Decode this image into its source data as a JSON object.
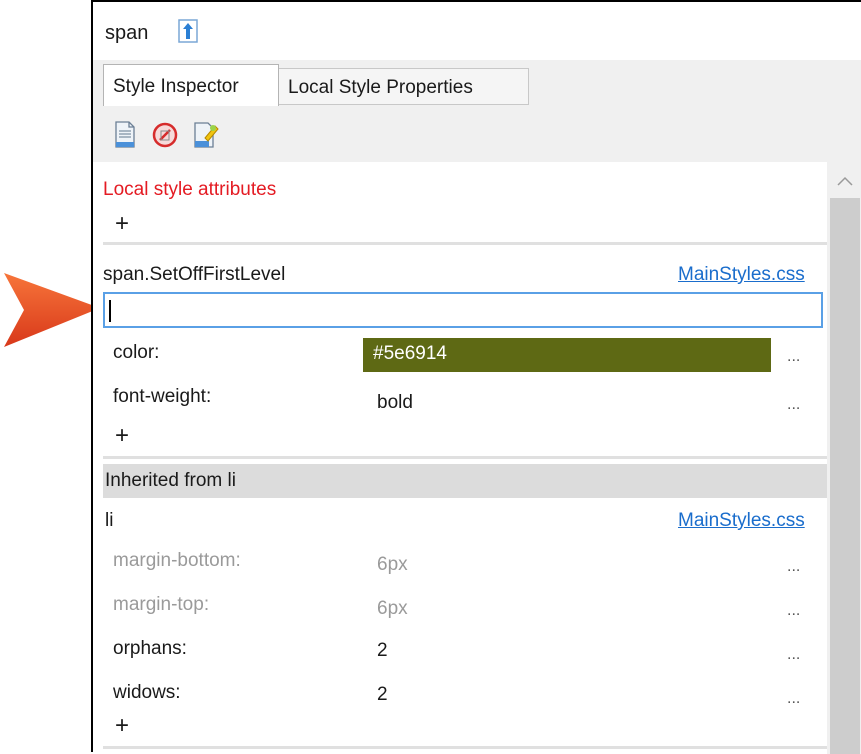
{
  "window": {
    "title": "span"
  },
  "tabs": [
    {
      "label": "Style Inspector",
      "active": true
    },
    {
      "label": "Local Style Properties",
      "active": false
    }
  ],
  "toolbar": {
    "icons": [
      "new-style-icon",
      "remove-style-icon",
      "edit-style-icon"
    ]
  },
  "local": {
    "heading": "Local style attributes",
    "add": "+"
  },
  "rule1": {
    "selector": "span.SetOffFirstLevel",
    "source": "MainStyles.css",
    "new_property_value": "",
    "add": "+",
    "properties": [
      {
        "name": "color:",
        "value": "#5e6914",
        "swatch": "#5e6914",
        "more": "..."
      },
      {
        "name": "font-weight:",
        "value": "bold",
        "more": "..."
      }
    ]
  },
  "inherited": {
    "heading": "Inherited from li",
    "selector": "li",
    "source": "MainStyles.css",
    "add": "+",
    "properties": [
      {
        "name": "margin-bottom:",
        "value": "6px",
        "more": "...",
        "disabled": true
      },
      {
        "name": "margin-top:",
        "value": "6px",
        "more": "...",
        "disabled": true
      },
      {
        "name": "orphans:",
        "value": "2",
        "more": "..."
      },
      {
        "name": "widows:",
        "value": "2",
        "more": "..."
      }
    ]
  },
  "colors": {
    "accent_arrow": "#ef4a23",
    "link": "#1a6dcc",
    "heading_red": "#e41b23"
  }
}
